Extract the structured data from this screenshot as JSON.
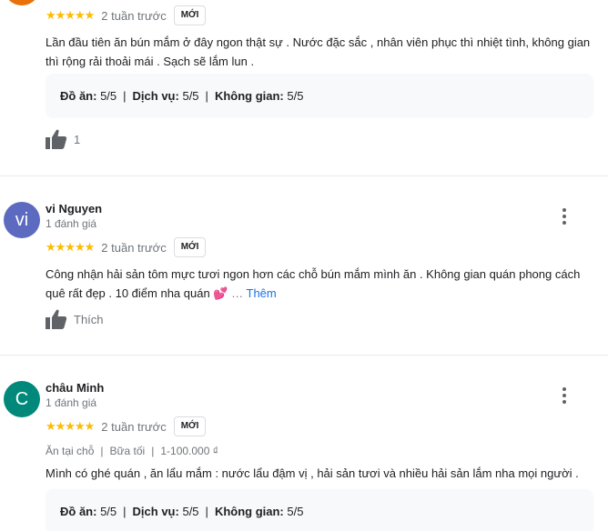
{
  "reviews": [
    {
      "stars": "★★★★★",
      "time": "2 tuần trước",
      "badge": "MỚI",
      "text": "Lần đầu tiên ăn bún mắm ở đây ngon thật sự . Nước đặc sắc , nhân viên phục thì nhiệt tình, không gian thì rộng rải thoải mái . Sạch sẽ lắm lun .",
      "ratings": {
        "food_label": "Đồ ăn:",
        "food_value": "5/5",
        "service_label": "Dịch vụ:",
        "service_value": "5/5",
        "space_label": "Không gian:",
        "space_value": "5/5"
      },
      "likes": "1"
    },
    {
      "avatar_letter": "vi",
      "avatar_color": "#5c6bc0",
      "name": "vi Nguyen",
      "count": "1 đánh giá",
      "stars": "★★★★★",
      "time": "2 tuần trước",
      "badge": "MỚI",
      "text": "Công nhận hải sản tôm mực tươi ngon hơn các chỗ bún mắm mình ăn . Không gian quán phong cách quê rất đẹp . 10 điểm nha quán 💕",
      "ellipsis": "…",
      "more": "Thêm",
      "likes": "Thích"
    },
    {
      "avatar_letter": "C",
      "avatar_color": "#00897b",
      "name": "châu Minh",
      "count": "1 đánh giá",
      "stars": "★★★★★",
      "time": "2 tuần trước",
      "badge": "MỚI",
      "meta": {
        "dine": "Ăn tại chỗ",
        "meal": "Bữa tối",
        "price": "1-100.000 ₫"
      },
      "text": "Mình có ghé quán ,  ăn lẩu mắm : nước lẩu đậm vị , hải sản tươi  và nhiều hải sản lắm nha mọi người .",
      "ratings": {
        "food_label": "Đồ ăn:",
        "food_value": "5/5",
        "service_label": "Dịch vụ:",
        "service_value": "5/5",
        "space_label": "Không gian:",
        "space_value": "5/5"
      }
    }
  ],
  "colors": {
    "star": "#fbbc04",
    "link": "#1a73e8",
    "muted": "#70757a"
  },
  "icons": {
    "like": "thumbs-up-icon",
    "more": "more-vert-icon"
  }
}
